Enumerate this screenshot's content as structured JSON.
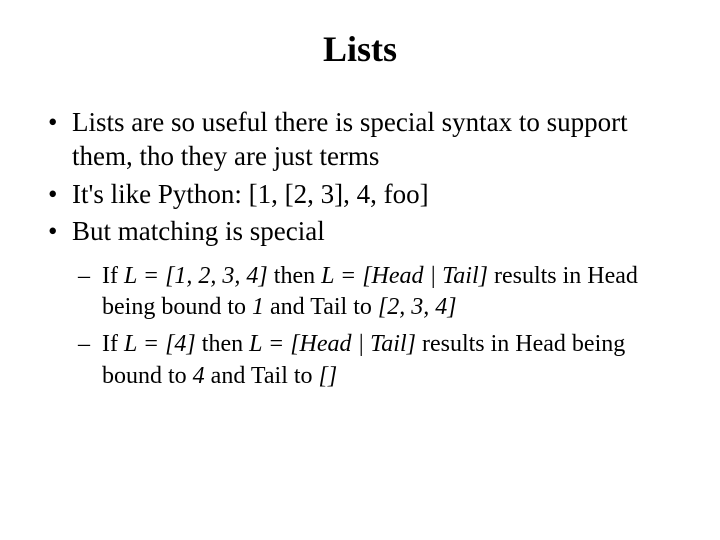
{
  "title": "Lists",
  "bullets": {
    "b1": "Lists are so useful there is special syntax to support them, tho they are just terms",
    "b2": "It's like Python: [1, [2, 3], 4, foo]",
    "b3": "But matching is special"
  },
  "sub": {
    "s1": {
      "p1": "If ",
      "p2": "L = [1, 2, 3, 4]",
      "p3": " then ",
      "p4": "L = [Head | Tail]",
      "p5": " results in Head being bound to ",
      "p6": "1",
      "p7": " and Tail to ",
      "p8": "[2, 3, 4]"
    },
    "s2": {
      "p1": "If ",
      "p2": "L = [4]",
      "p3": " then ",
      "p4": "L = [Head | Tail]",
      "p5": " results in Head being bound to ",
      "p6": "4",
      "p7": " and Tail to ",
      "p8": "[]"
    }
  }
}
